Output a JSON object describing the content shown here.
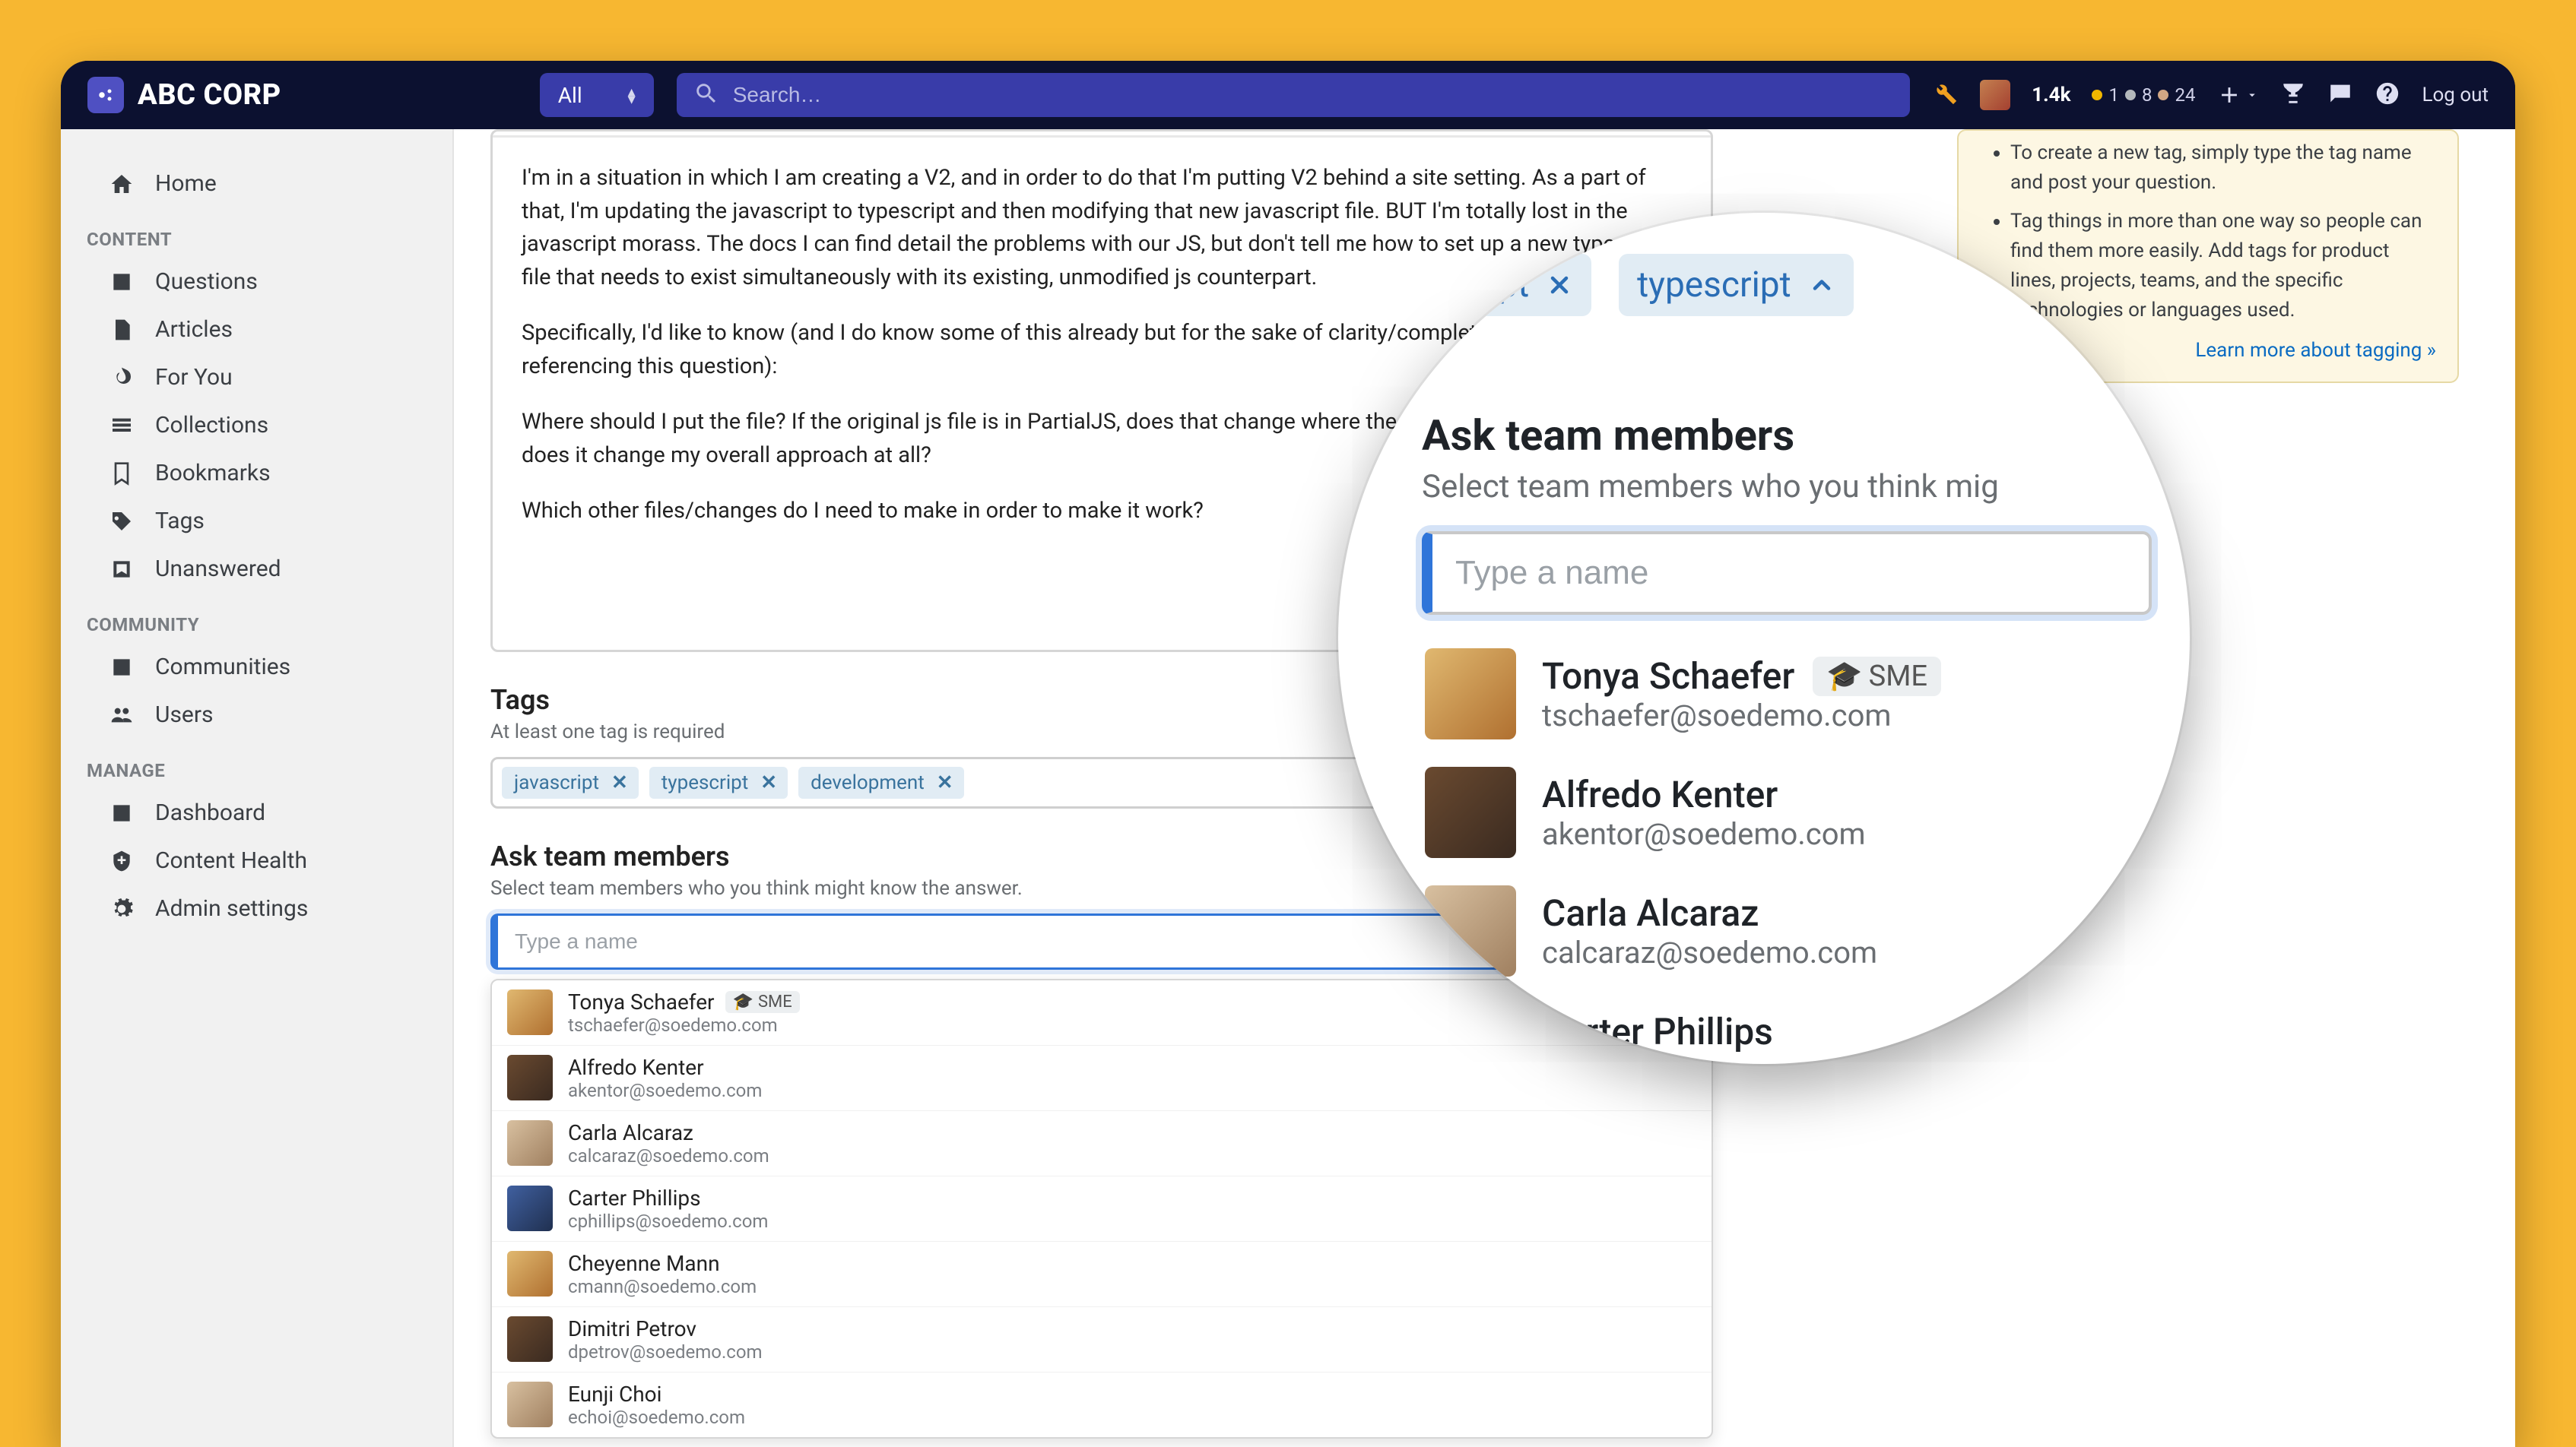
{
  "brand": {
    "name": "ABC CORP"
  },
  "search": {
    "scope": "All",
    "placeholder": "Search…"
  },
  "topstats": {
    "rep": "1.4k",
    "gold": "1",
    "silver": "8",
    "bronze": "24",
    "logout": "Log out"
  },
  "sidebar": {
    "home": "Home",
    "groups": {
      "content": "CONTENT",
      "community": "COMMUNITY",
      "manage": "MANAGE"
    },
    "content_items": [
      "Questions",
      "Articles",
      "For You",
      "Collections",
      "Bookmarks",
      "Tags",
      "Unanswered"
    ],
    "community_items": [
      "Communities",
      "Users"
    ],
    "manage_items": [
      "Dashboard",
      "Content Health",
      "Admin settings"
    ]
  },
  "editor": {
    "p1": "I'm in a situation in which I am creating a V2, and in order to do that I'm putting V2 behind a site setting. As a part of that, I'm updating the javascript to typescript and then modifying that new javascript file. BUT I'm totally lost in the javascript morass. The docs I can find detail the problems with our JS, but don't tell me how to set up a new typescript file that needs to exist simultaneously with its existing, unmodified js counterpart.",
    "p2": "Specifically, I'd like to know (and I do know some of this already but for the sake of clarity/completeness for other folks referencing this question):",
    "p3": "Where should I put the file? If the original js file is in PartialJS, does that change where the new ts file should live, and does it change my overall approach at all?",
    "p4": "Which other files/changes do I need to make in order to make it work?"
  },
  "tags_section": {
    "title": "Tags",
    "subtitle": "At least one tag is required",
    "chips": [
      "javascript",
      "typescript",
      "development"
    ]
  },
  "ask_section": {
    "title": "Ask team members",
    "subtitle": "Select team members who you think might know the answer.",
    "placeholder": "Type a name"
  },
  "members": [
    {
      "name": "Tonya Schaefer",
      "email": "tschaefer@soedemo.com",
      "sme": true
    },
    {
      "name": "Alfredo Kenter",
      "email": "akentor@soedemo.com",
      "sme": false
    },
    {
      "name": "Carla Alcaraz",
      "email": "calcaraz@soedemo.com",
      "sme": false
    },
    {
      "name": "Carter Phillips",
      "email": "cphillips@soedemo.com",
      "sme": false
    },
    {
      "name": "Cheyenne Mann",
      "email": "cmann@soedemo.com",
      "sme": false
    },
    {
      "name": "Dimitri Petrov",
      "email": "dpetrov@soedemo.com",
      "sme": false
    },
    {
      "name": "Eunji Choi",
      "email": "echoi@soedemo.com",
      "sme": false
    }
  ],
  "sme_label": "SME",
  "tips": {
    "li1": "To create a new tag, simply type the tag name and post your question.",
    "li2": "Tag things in more than one way so people can find them more easily. Add tags for product lines, projects, teams, and the specific technologies or languages used.",
    "link": "Learn more about tagging »"
  },
  "magnifier": {
    "tags": [
      "avascript",
      "typescript"
    ],
    "title": "Ask team members",
    "subtitle": "Select team members who you think mig",
    "placeholder": "Type a name",
    "members": [
      {
        "name": "Tonya Schaefer",
        "email": "tschaefer@soedemo.com",
        "sme": true
      },
      {
        "name": "Alfredo Kenter",
        "email": "akentor@soedemo.com",
        "sme": false
      },
      {
        "name": "Carla Alcaraz",
        "email": "calcaraz@soedemo.com",
        "sme": false
      },
      {
        "name": "Carter Phillips",
        "email": "cphillips@soe",
        "sme": false
      }
    ]
  }
}
